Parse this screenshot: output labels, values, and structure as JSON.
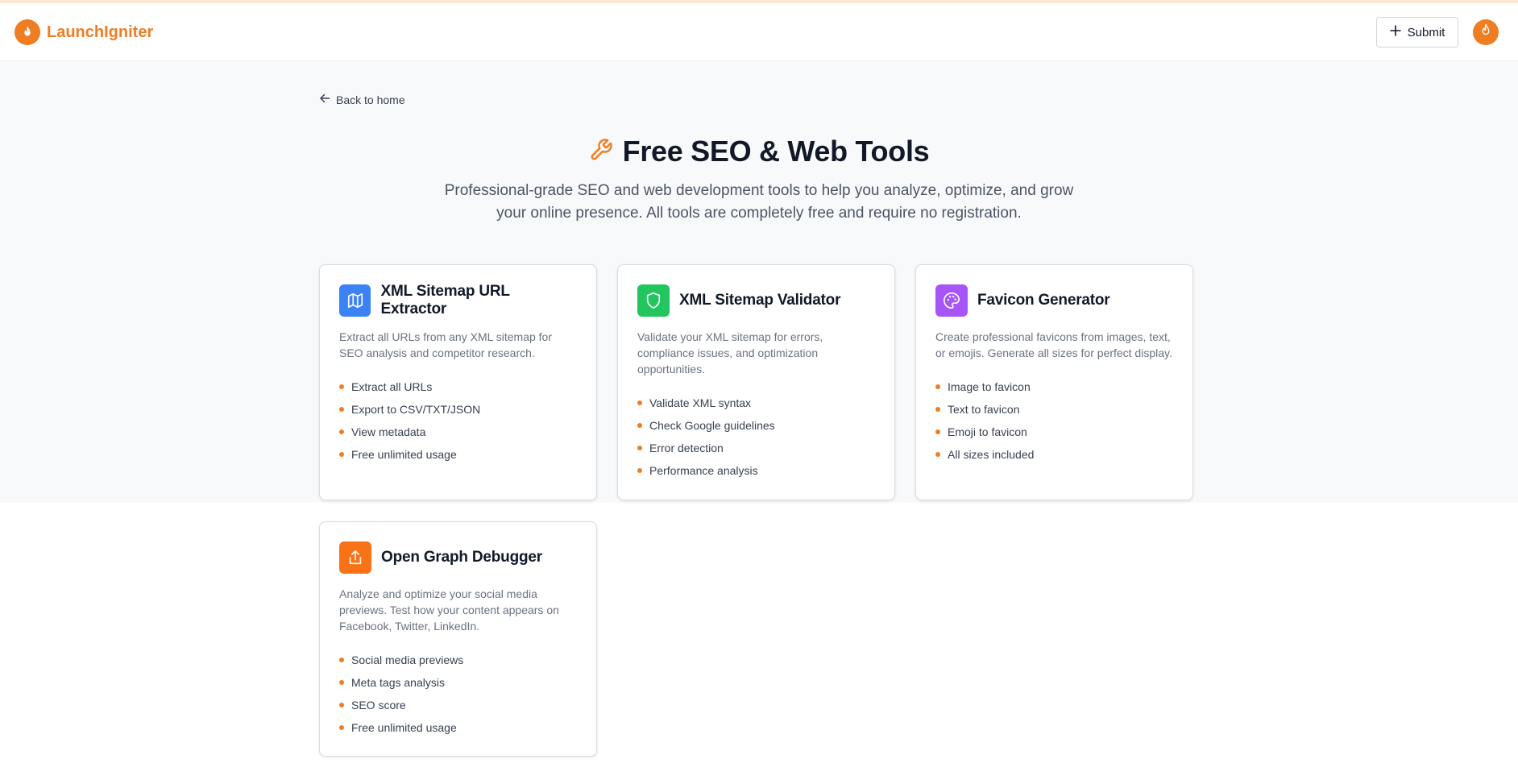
{
  "brand": {
    "name": "LaunchIgniter",
    "accent": "#ef7d22"
  },
  "header": {
    "submit_label": "Submit",
    "plus_icon": "plus-icon",
    "avatar_icon": "flame-icon"
  },
  "nav": {
    "back_label": "Back to home"
  },
  "hero": {
    "title": "Free SEO & Web Tools",
    "icon": "wrench-icon",
    "subtitle": "Professional-grade SEO and web development tools to help you analyze, optimize, and grow your online presence. All tools are completely free and require no registration."
  },
  "tools": [
    {
      "title": "XML Sitemap URL Extractor",
      "icon": "map-icon",
      "icon_color": "#3b82f6",
      "description": "Extract all URLs from any XML sitemap for SEO analysis and competitor research.",
      "features": [
        "Extract all URLs",
        "Export to CSV/TXT/JSON",
        "View metadata",
        "Free unlimited usage"
      ]
    },
    {
      "title": "XML Sitemap Validator",
      "icon": "shield-icon",
      "icon_color": "#22c55e",
      "description": "Validate your XML sitemap for errors, compliance issues, and optimization opportunities.",
      "features": [
        "Validate XML syntax",
        "Check Google guidelines",
        "Error detection",
        "Performance analysis"
      ]
    },
    {
      "title": "Favicon Generator",
      "icon": "palette-icon",
      "icon_color": "#a855f7",
      "description": "Create professional favicons from images, text, or emojis. Generate all sizes for perfect display.",
      "features": [
        "Image to favicon",
        "Text to favicon",
        "Emoji to favicon",
        "All sizes included"
      ]
    },
    {
      "title": "Open Graph Debugger",
      "icon": "share-icon",
      "icon_color": "#f97316",
      "description": "Analyze and optimize your social media previews. Test how your content appears on Facebook, Twitter, LinkedIn.",
      "features": [
        "Social media previews",
        "Meta tags analysis",
        "SEO score",
        "Free unlimited usage"
      ]
    }
  ]
}
